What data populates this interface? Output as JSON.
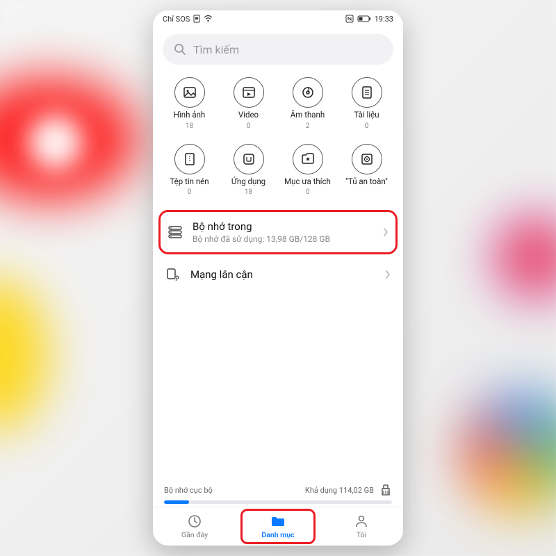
{
  "statusbar": {
    "carrier": "Chỉ SOS",
    "time": "19:33"
  },
  "search": {
    "placeholder": "Tìm kiếm"
  },
  "categories": [
    {
      "key": "images",
      "label": "Hình ảnh",
      "count": "18"
    },
    {
      "key": "video",
      "label": "Video",
      "count": "0"
    },
    {
      "key": "audio",
      "label": "Âm thanh",
      "count": "2"
    },
    {
      "key": "documents",
      "label": "Tài liệu",
      "count": "0"
    },
    {
      "key": "archives",
      "label": "Tệp tin nén",
      "count": "0"
    },
    {
      "key": "apps",
      "label": "Ứng dụng",
      "count": "18"
    },
    {
      "key": "favorites",
      "label": "Mục ưa thích",
      "count": "0"
    },
    {
      "key": "safe",
      "label": "\"Tủ an toàn\"",
      "count": ""
    }
  ],
  "storage": {
    "title": "Bộ nhớ trong",
    "subtitle": "Bộ nhớ đã sử dụng: 13,98 GB/128 GB"
  },
  "network": {
    "title": "Mạng lân cận"
  },
  "local": {
    "label": "Bộ nhớ cục bộ",
    "available": "Khả dụng 114,02 GB"
  },
  "nav": {
    "recent": "Gần đây",
    "categories": "Danh mục",
    "me": "Tôi"
  }
}
